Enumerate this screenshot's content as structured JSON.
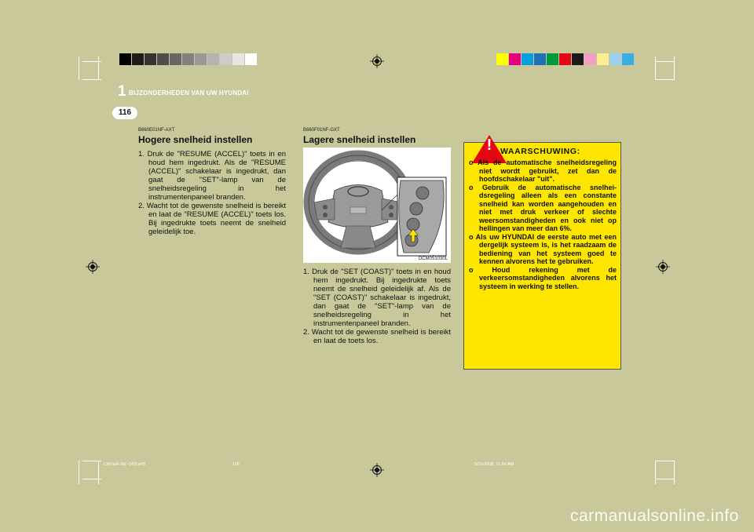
{
  "header": {
    "section_number": "1",
    "section_title": "BIJZONDERHEDEN VAN UW HYUNDAI",
    "page_number": "116"
  },
  "calibration": {
    "gray_bar": [
      "#000000",
      "#1c1c1c",
      "#333333",
      "#4d4d4d",
      "#666666",
      "#808080",
      "#999999",
      "#b3b3b3",
      "#cccccc",
      "#e6e6e6",
      "#ffffff"
    ],
    "color_bar": [
      "#ffff00",
      "#e6007e",
      "#00a0e3",
      "#1d71b8",
      "#009a3e",
      "#e30613",
      "#1a1a1a",
      "#f29fc5",
      "#ffeb91",
      "#9bd0f0",
      "#3aaee0"
    ]
  },
  "left_section": {
    "code": "B660E01NF-AXT",
    "heading": "Hogere snelheid instellen",
    "items": [
      "1. Druk de  \"RESUME (ACCEL)\" toets in en houd hem ingedrukt. Als de \"RESUME (ACCEL)\" schakelaar is ingedrukt, dan gaat de \"SET\"-lamp van de snelheidsregeling in het instrumentenpaneel branden.",
      "2. Wacht tot de gewenste snelheid is bereikt en laat de \"RESUME (ACCEL)\" toets los. Bij ingedrukte toets neemt de snelheid geleidelijk toe."
    ]
  },
  "middle_section": {
    "code": "B660F01NF-GXT",
    "heading": "Lagere snelheid instellen",
    "image_caption": "OCM051030L",
    "items": [
      "1. Druk de \"SET (COAST)\" toets in en houd hem ingedrukt. Bij ingedrukte toets neemt de snelheid geleidelijk af. Als de \"SET (COAST)\" schakelaar is ingedrukt, dan gaat de \"SET\"-lamp van de snelheidsregeling in het instrumentenpaneel branden.",
      "2. Wacht tot de gewenste snelheid is bereikt en laat de toets los."
    ]
  },
  "warning": {
    "icon": "!",
    "title": "WAARSCHUWING:",
    "items": [
      "o Als de automatische snelheidsregeling niet wordt gebruikt, zet dan de hoofdschakelaar \"uit\".",
      "o Gebruik de automatische snelhei-dsregeling alleen als een constante snelheid kan worden aangehouden en niet met druk verkeer of slechte weersomstandigheden en ook niet op hellingen van  meer dan 6%.",
      "o Als uw HYUNDAI de eerste auto met een dergelijk systeem is, is het raadzaam de bediening van het systeem goed te kennen alvorens het te gebruiken.",
      "o Houd rekening met de verkeersomstandigheden alvorens het systeem in werking te stellen."
    ]
  },
  "footer": {
    "file": "CM holl-1b(~143).p65",
    "page": "116",
    "timestamp": "5/21/2008, 11:56 AM"
  },
  "watermark": "carmanualsonline.info"
}
